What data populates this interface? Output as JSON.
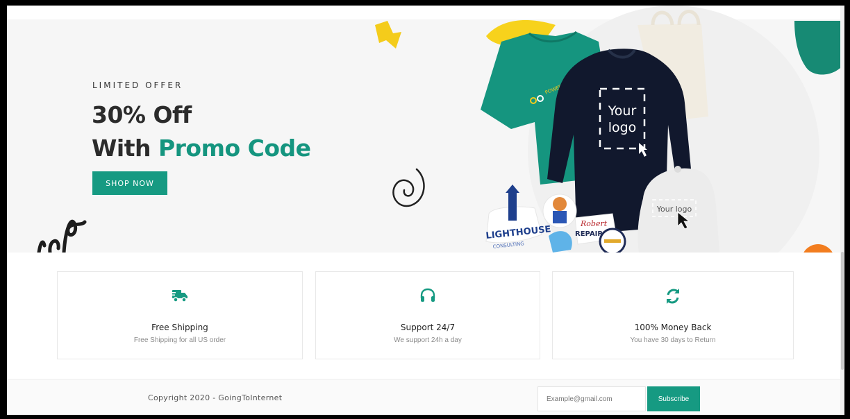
{
  "hero": {
    "kicker": "LIMITED OFFER",
    "title_line1": "30% Off",
    "title_line2_prefix": "With ",
    "title_line2_accent": "Promo Code",
    "cta_label": "SHOP NOW",
    "mockup": {
      "sweatshirt_logo_line1": "Your",
      "sweatshirt_logo_line2": "logo",
      "cap_logo": "Your logo",
      "tshirt_brand": "POWER UP",
      "sticker_lighthouse": "LIGHTHOUSE",
      "sticker_lighthouse_sub": "CONSULTING",
      "sticker_robert": "Robert",
      "sticker_repairman": "REPAIRMAN"
    }
  },
  "features": [
    {
      "icon": "truck-icon",
      "title": "Free Shipping",
      "description": "Free Shipping for all US order"
    },
    {
      "icon": "headphones-icon",
      "title": "Support 24/7",
      "description": "We support 24h a day"
    },
    {
      "icon": "refresh-icon",
      "title": "100% Money Back",
      "description": "You have 30 days to Return"
    }
  ],
  "footer": {
    "copyright": "Copyright 2020 - GoingToInternet",
    "email_placeholder": "Example@gmail.com",
    "subscribe_label": "Subscribe"
  },
  "colors": {
    "accent": "#169a82",
    "title_text": "#2b2b2b",
    "hero_bg": "#f6f6f6"
  }
}
